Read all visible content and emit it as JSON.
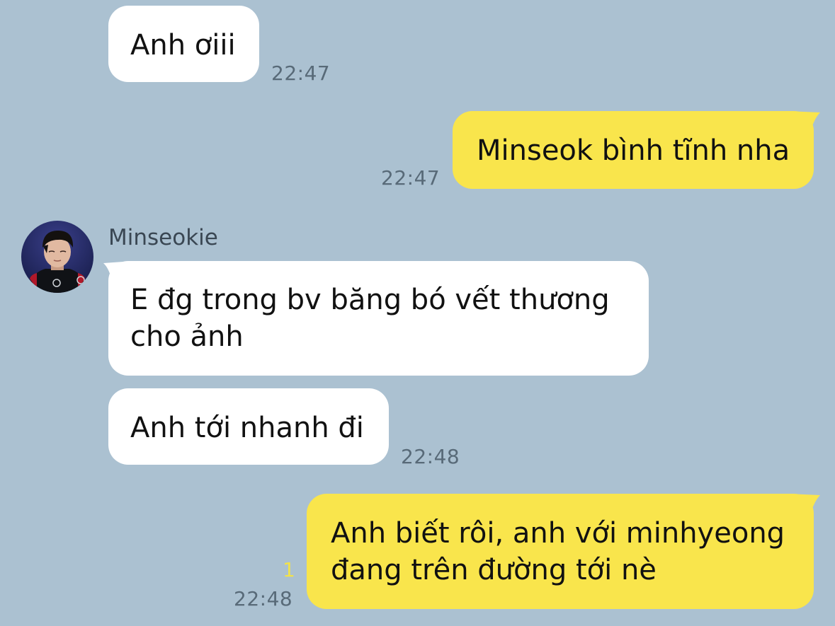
{
  "contact": {
    "name": "Minseokie",
    "avatar_icon": "person-photo-avatar"
  },
  "colors": {
    "background": "#abc1d1",
    "incoming_bubble": "#ffffff",
    "outgoing_bubble": "#f9e54c",
    "timestamp": "#586a78",
    "unread_count": "#f2e24a"
  },
  "messages": [
    {
      "direction": "incoming",
      "text": "Anh ơiii",
      "time": "22:47"
    },
    {
      "direction": "outgoing",
      "text": "Minseok bình tĩnh nha",
      "time": "22:47"
    },
    {
      "direction": "incoming",
      "sender": "Minseokie",
      "lines": [
        "E đg trong bv băng bó vết thương",
        "cho ảnh"
      ]
    },
    {
      "direction": "incoming",
      "text": "Anh tới nhanh đi",
      "time": "22:48"
    },
    {
      "direction": "outgoing",
      "lines": [
        "Anh biết rôi, anh với minhyeong",
        "đang trên đường tới nè"
      ],
      "time": "22:48",
      "unread": "1"
    }
  ]
}
